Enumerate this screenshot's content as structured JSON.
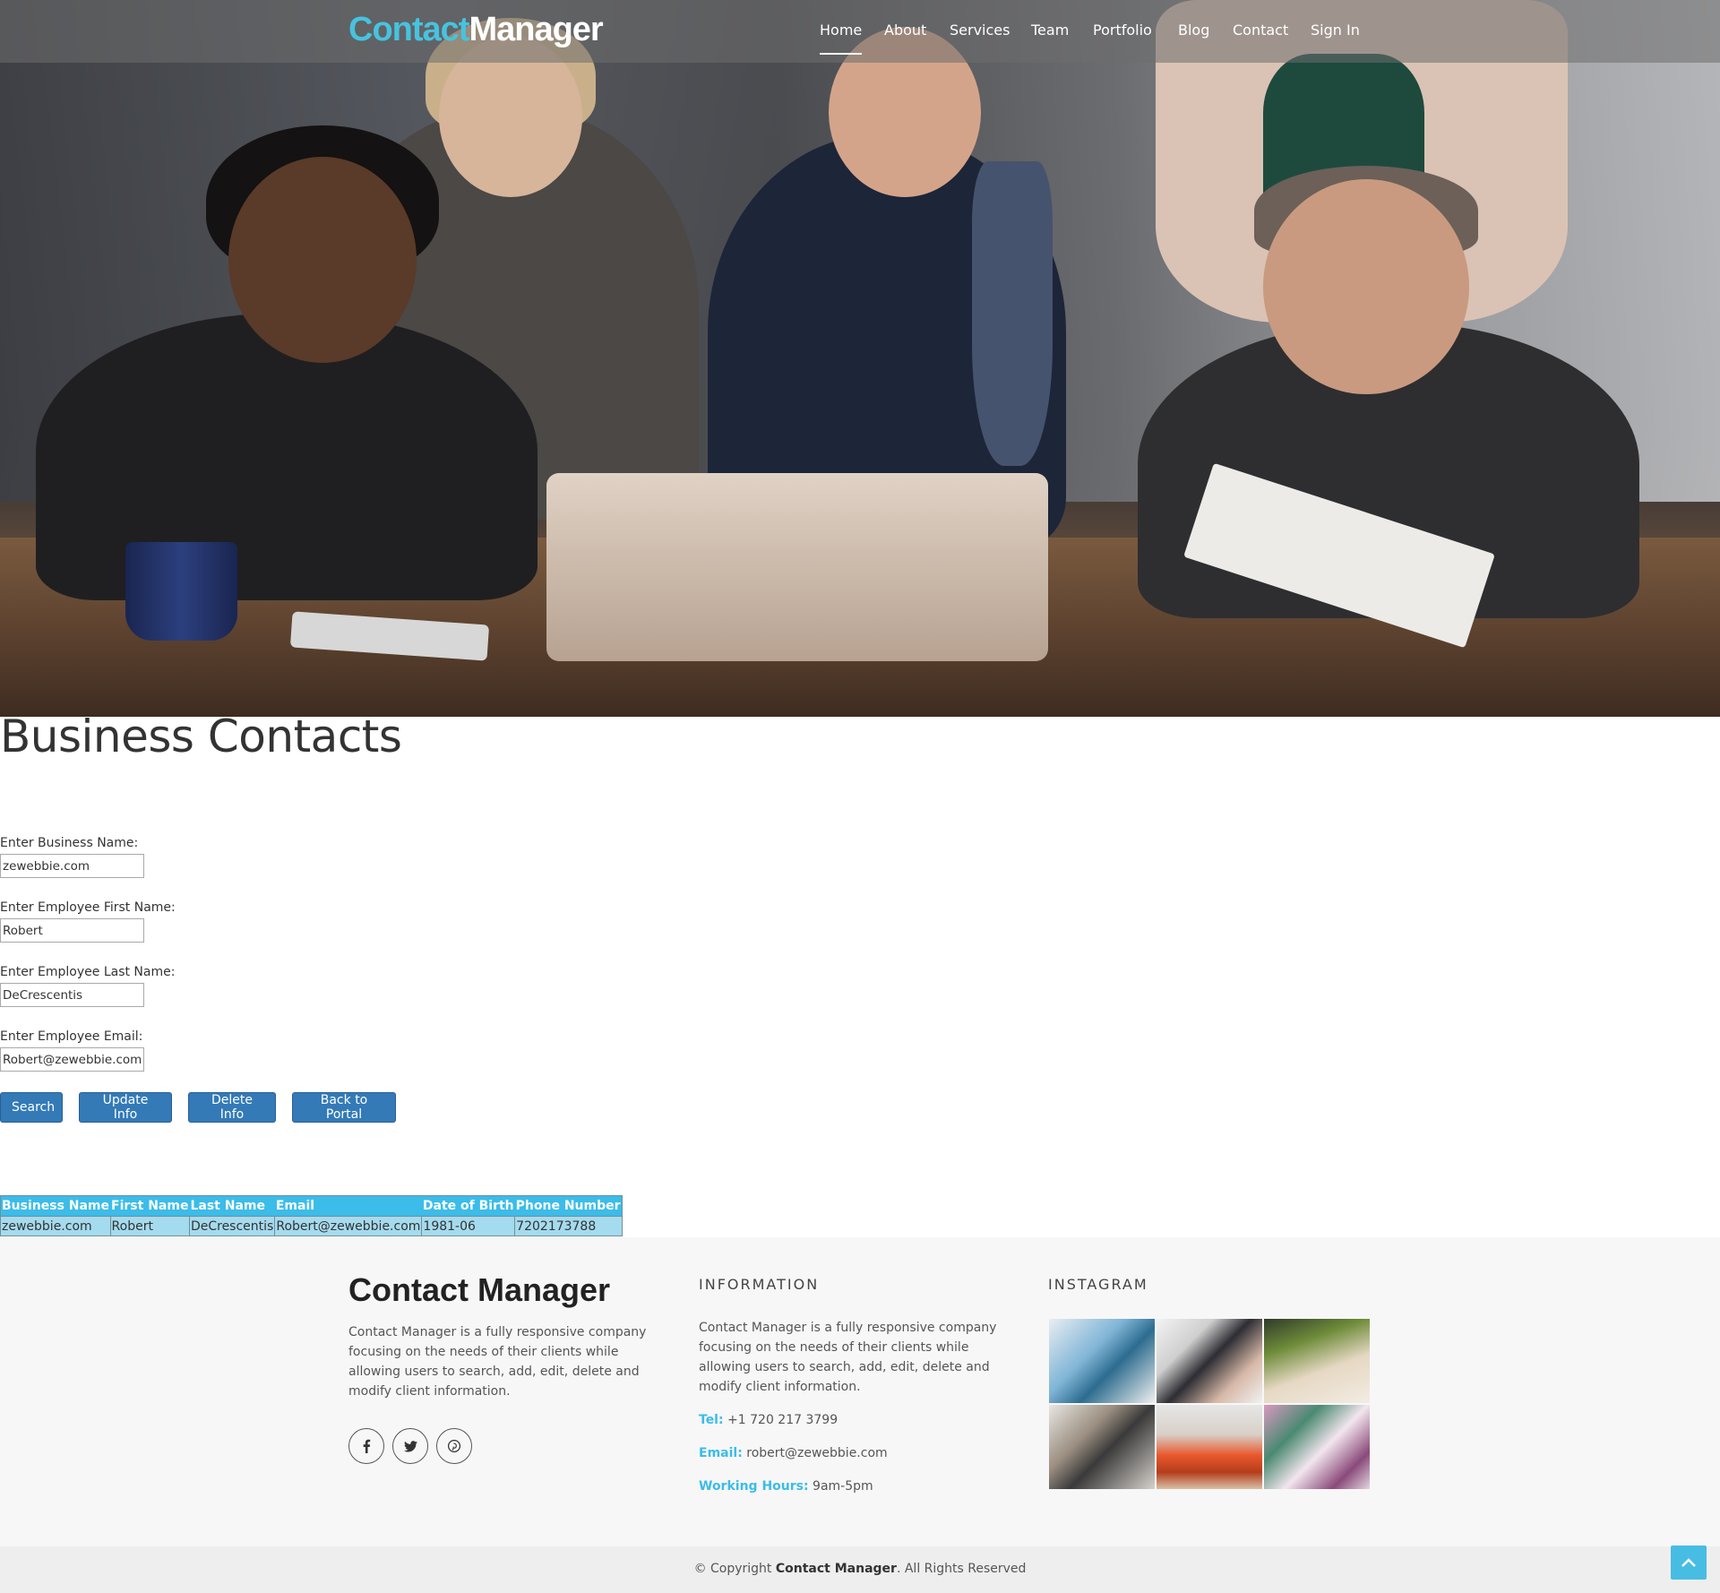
{
  "brand": {
    "part1": "Contact",
    "part2": "Manager",
    "accent": "#46c3df"
  },
  "nav": {
    "items": [
      "Home",
      "About",
      "Services",
      "Team",
      "Portfolio",
      "Blog",
      "Contact",
      "Sign In"
    ],
    "active": "Home"
  },
  "hero": {
    "image": "business-team-meeting-photo"
  },
  "main": {
    "title": "Business Contacts",
    "form": {
      "business_label": "Enter Business Name:",
      "business_value": "zewebbie.com",
      "first_label": "Enter Employee First Name:",
      "first_value": "Robert",
      "last_label": "Enter Employee Last Name:",
      "last_value": "DeCrescentis",
      "email_label": "Enter Employee Email:",
      "email_value": "Robert@zewebbie.com"
    },
    "buttons": {
      "search": "Search",
      "update": "Update Info",
      "delete": "Delete Info",
      "back": "Back to Portal"
    },
    "table": {
      "headers": [
        "Business Name",
        "First Name",
        "Last Name",
        "Email",
        "Date of Birth",
        "Phone Number"
      ],
      "rows": [
        [
          "zewebbie.com",
          "Robert",
          "DeCrescentis",
          "Robert@zewebbie.com",
          "1981-06",
          "7202173788"
        ]
      ]
    }
  },
  "footer": {
    "title": "Contact Manager",
    "about": "Contact Manager is a fully responsive company focusing on the needs of their clients while allowing users to search, add, edit, delete and modify client information.",
    "social": [
      "facebook-icon",
      "twitter-icon",
      "pinterest-icon"
    ],
    "info_heading": "INFORMATION",
    "info_text": "Contact Manager is a fully responsive company focusing on the needs of their clients while allowing users to search, add, edit, delete and modify client information.",
    "tel_label": "Tel:",
    "tel": "+1 720 217 3799",
    "email_label": "Email:",
    "email": "robert@zewebbie.com",
    "hours_label": "Working Hours:",
    "hours": "9am-5pm",
    "instagram_heading": "INSTAGRAM",
    "copyright_prefix": "© Copyright",
    "copyright_brand": "Contact Manager",
    "copyright_suffix": ". All Rights Reserved"
  }
}
